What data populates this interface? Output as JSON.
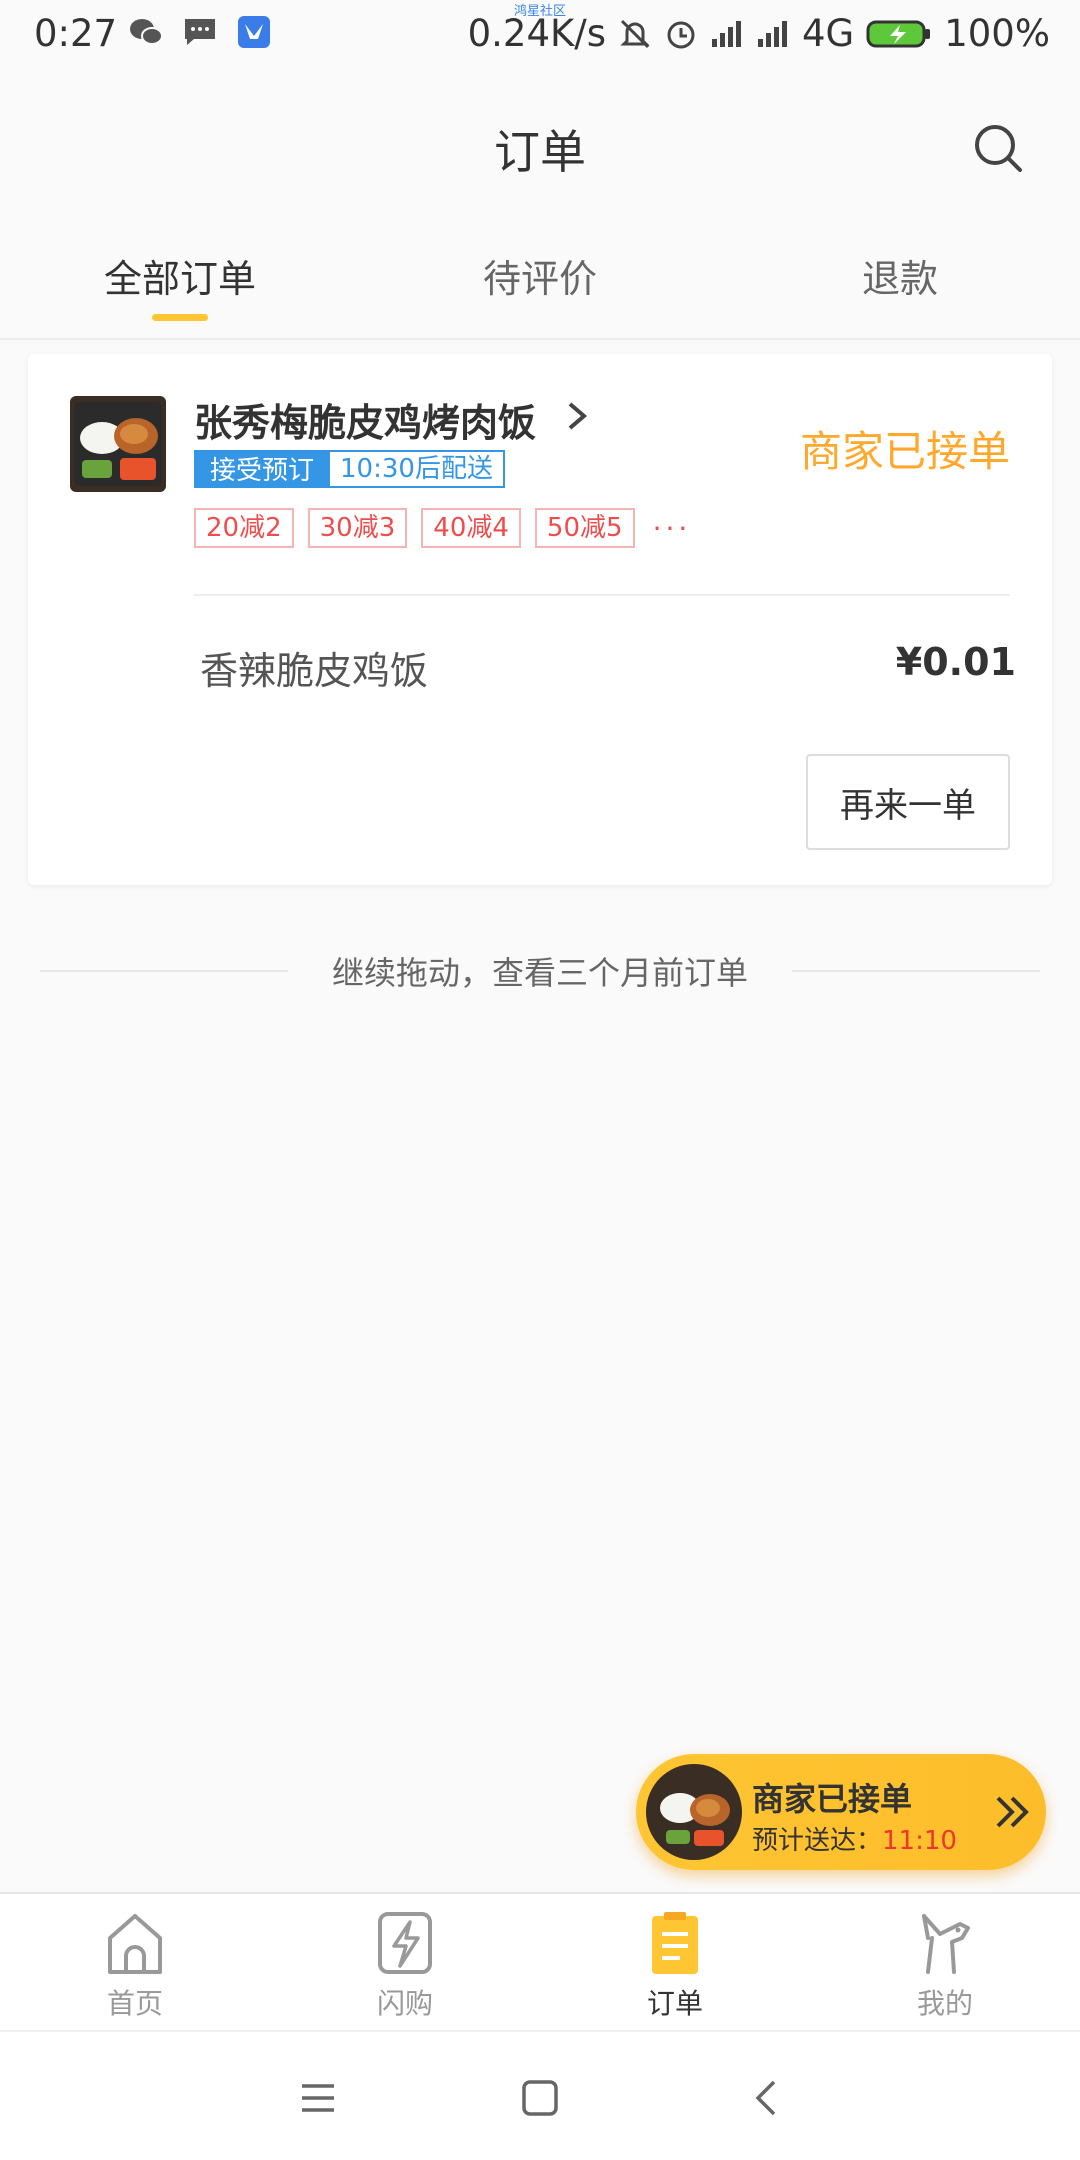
{
  "status_bar": {
    "time": "0:27",
    "net_tag": "鸿星社区",
    "speed": "0.24K/s",
    "network": "4G",
    "battery": "100%"
  },
  "header": {
    "title": "订单"
  },
  "tabs": [
    {
      "label": "全部订单",
      "active": true
    },
    {
      "label": "待评价",
      "active": false
    },
    {
      "label": "退款",
      "active": false
    }
  ],
  "order": {
    "store_name": "张秀梅脆皮鸡烤肉饭",
    "status": "商家已接单",
    "tag_fill": "接受预订",
    "tag_outline": "10:30后配送",
    "promos": [
      "20减2",
      "30减3",
      "40减4",
      "50减5"
    ],
    "promo_more": "···",
    "item_name": "香辣脆皮鸡饭",
    "item_price": "¥0.01",
    "reorder_label": "再来一单"
  },
  "hint": "继续拖动，查看三个月前订单",
  "float_bubble": {
    "title": "商家已接单",
    "sub_prefix": "预计送达：",
    "time": "11:10"
  },
  "bottom_nav": [
    {
      "label": "首页",
      "icon": "home-icon",
      "active": false
    },
    {
      "label": "闪购",
      "icon": "flash-icon",
      "active": false
    },
    {
      "label": "订单",
      "icon": "order-icon",
      "active": true
    },
    {
      "label": "我的",
      "icon": "profile-icon",
      "active": false
    }
  ],
  "colors": {
    "accent": "#ffc533",
    "status_orange": "#ffa82c",
    "promo_red": "#ef4d4d",
    "tag_blue": "#3496e5"
  }
}
